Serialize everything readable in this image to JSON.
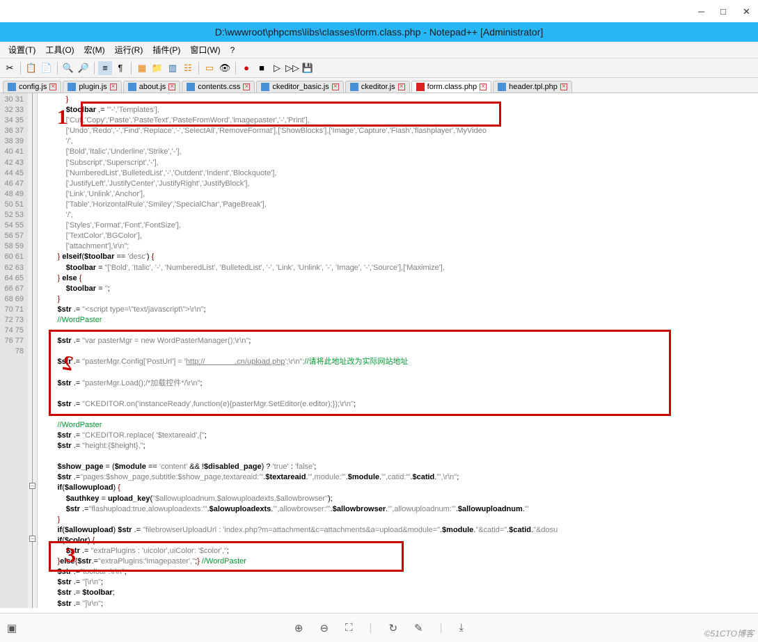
{
  "window": {
    "title": "D:\\wwwroot\\phpcms\\libs\\classes\\form.class.php - Notepad++ [Administrator]"
  },
  "menu": {
    "settings": "设置(T)",
    "tools": "工具(O)",
    "macro": "宏(M)",
    "run": "运行(R)",
    "plugins": "插件(P)",
    "window": "窗口(W)",
    "help": "?"
  },
  "tabs": [
    {
      "label": "config.js"
    },
    {
      "label": "plugin.js"
    },
    {
      "label": "about.js"
    },
    {
      "label": "contents.css"
    },
    {
      "label": "ckeditor_basic.js"
    },
    {
      "label": "ckeditor.js"
    },
    {
      "label": "form.class.php"
    },
    {
      "label": "header.tpl.php"
    }
  ],
  "active_tab": 6,
  "lines": {
    "start": 30,
    "end": 78
  },
  "code": {
    "l30": "            }",
    "l31_a": "            $toolbar .= \"'-','Templates'],",
    "l32_a": "            ['Cut','Copy','Paste','PasteText','PasteFromWord','imagepaster','-','Print'],",
    "l33_a": "            ['Undo','Redo','-','Find','Replace','-','SelectAll','RemoveFormat'],['ShowBlocks'],['Image','Capture','Flash','flashplayer','MyVideo",
    "l34": "            '/',",
    "l35": "            ['Bold','Italic','Underline','Strike','-'],",
    "l36": "            ['Subscript','Superscript','-'],",
    "l37": "            ['NumberedList','BulletedList','-','Outdent','Indent','Blockquote'],",
    "l38": "            ['JustifyLeft','JustifyCenter','JustifyRight','JustifyBlock'],",
    "l39": "            ['Link','Unlink','Anchor'],",
    "l40": "            ['Table','HorizontalRule','Smiley','SpecialChar','PageBreak'],",
    "l41": "            '/',",
    "l42": "            ['Styles','Format','Font','FontSize'],",
    "l43": "            ['TextColor','BGColor'],",
    "l44": "            ['attachment'],\\r\\n\";",
    "l45_a": "        } elseif($toolbar == 'desc') {",
    "l46_a": "            $toolbar = \"['Bold', 'Italic', '-', 'NumberedList', 'BulletedList', '-', 'Link', 'Unlink', '-', 'Image', '-','Source'],['Maximize'],",
    "l47_a": "        } else {",
    "l48_a": "            $toolbar = '';",
    "l49": "        }",
    "l50_a": "        $str .= \"<script type=\\\"text/javascript\\\">\\r\\n\";",
    "l51_cmt": "        //WordPaster",
    "l52": "",
    "l53_a": "        $str .= \"var pasterMgr = new WordPasterManager();\\r\\n\";",
    "l54": "",
    "l55_a": "        $str .= \"pasterMgr.Config['PostUrl'] = '",
    "l55_url": "http://              .cn/upload.php",
    "l55_b": "';\\r\\n\";",
    "l55_cmt": "//请将此地址改为实际网站地址",
    "l56": "",
    "l57_a": "        $str .= \"pasterMgr.Load();/*加载控件*/\\r\\n\";",
    "l58": "",
    "l59_a": "        $str .= \"CKEDITOR.on('instanceReady',function(e){pasterMgr.SetEditor(e.editor);});\\r\\n\";",
    "l60": "",
    "l61_cmt": "        //WordPaster",
    "l62_a": "        $str .= \"CKEDITOR.replace( '$textareaid',{\";",
    "l63_a": "        $str .= \"height:{$height},\";",
    "l64": "",
    "l65_a": "        $show_page = ($module == 'content' && !$disabled_page) ? 'true' : 'false';",
    "l66_a": "        $str .=\"pages:$show_page,subtitle:$show_page,textareaid:'\".$textareaid.\"',module:'\".$module.\"',catid:'\".$catid.\"',\\r\\n\";",
    "l67_a": "        if($allowupload) {",
    "l68_a": "            $authkey = upload_key(\"$allowuploadnum,$alowuploadexts,$allowbrowser\");",
    "l69_a": "            $str .=\"flashupload:true,alowuploadexts:'\".$alowuploadexts.\"',allowbrowser:'\".$allowbrowser.\"',allowuploadnum:'\".$allowuploadnum.\"'",
    "l70": "        }",
    "l71_a": "        if($allowupload) $str .= \"filebrowserUploadUrl : 'index.php?m=attachment&c=attachments&a=upload&module=\".$module.\"&catid=\".$catid.\"&dosu",
    "l72_a": "        if($color) {",
    "l73_a": "            $str .= \"extraPlugins : 'uicolor',uiColor: '$color',\";",
    "l74_a": "        }else{$str.=\"extraPlugins:'imagepaster',\";} ",
    "l74_cmt": "//WordPaster",
    "l75_a": "        $str .=\"toolbar :\\r\\n\";",
    "l76_a": "        $str .= \"[\\r\\n\";",
    "l77_a": "        $str .= $toolbar;",
    "l78_a": "        $str .= \"]\\r\\n\";"
  },
  "watermark": "©51CTO博客"
}
